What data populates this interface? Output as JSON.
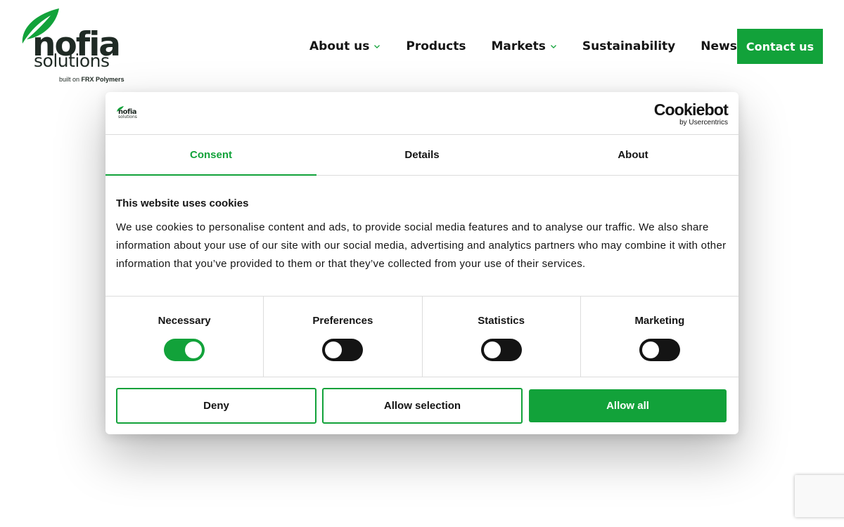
{
  "brand": {
    "logo_word": "nofia",
    "logo_sub": "solutions",
    "logo_tag_prefix": "built on",
    "logo_tag_brand": "FRX Polymers",
    "brand_color": "#12a23a",
    "dark_color": "#1f2a24"
  },
  "nav": {
    "items": [
      {
        "label": "About us",
        "has_dropdown": true
      },
      {
        "label": "Products",
        "has_dropdown": false
      },
      {
        "label": "Markets",
        "has_dropdown": true
      },
      {
        "label": "Sustainability",
        "has_dropdown": false
      },
      {
        "label": "News",
        "has_dropdown": false
      }
    ],
    "cta_label": "Contact us"
  },
  "cookie_dialog": {
    "provider_name": "Cookiebot",
    "provider_by": "by Usercentrics",
    "mini_logo_word": "nofia",
    "mini_logo_sub": "solutions",
    "tabs": [
      {
        "label": "Consent",
        "active": true
      },
      {
        "label": "Details",
        "active": false
      },
      {
        "label": "About",
        "active": false
      }
    ],
    "title": "This website uses cookies",
    "description": "We use cookies to personalise content and ads, to provide social media features and to analyse our traffic. We also share information about your use of our site with our social media, advertising and analytics partners who may combine it with other information that you’ve provided to them or that they’ve collected from your use of their services.",
    "categories": [
      {
        "label": "Necessary",
        "enabled": true
      },
      {
        "label": "Preferences",
        "enabled": false
      },
      {
        "label": "Statistics",
        "enabled": false
      },
      {
        "label": "Marketing",
        "enabled": false
      }
    ],
    "buttons": {
      "deny": "Deny",
      "allow_selection": "Allow selection",
      "allow_all": "Allow all"
    }
  }
}
